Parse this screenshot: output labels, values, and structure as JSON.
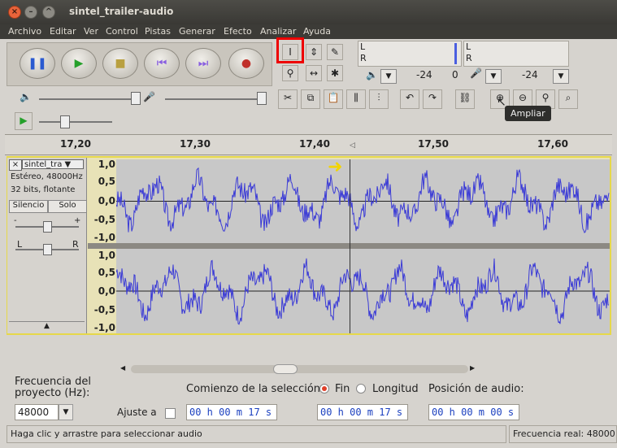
{
  "window": {
    "title": "sintel_trailer-audio"
  },
  "menu": [
    "Archivo",
    "Editar",
    "Ver",
    "Control",
    "Pistas",
    "Generar",
    "Efecto",
    "Analizar",
    "Ayuda"
  ],
  "meters": {
    "play_db": [
      "-24",
      "0"
    ],
    "rec_db": [
      "-24"
    ],
    "L": "L",
    "R": "R"
  },
  "tooltip": "Ampliar",
  "ruler": [
    "17,20",
    "17,30",
    "17,40",
    "17,50",
    "17,60"
  ],
  "track": {
    "name": "sintel_tra",
    "format": "Estéreo, 48000Hz",
    "bits": "32 bits, flotante",
    "mute": "Silencio",
    "solo": "Solo",
    "gain_minus": "-",
    "gain_plus": "+",
    "pan_l": "L",
    "pan_r": "R"
  },
  "scale": [
    "1,0",
    "0,5",
    "0,0",
    "-0,5",
    "-1,0"
  ],
  "bottom": {
    "rate_label": "Frecuencia del proyecto (Hz):",
    "rate_value": "48000",
    "snap_label": "Ajuste a",
    "selection_label": "Comienzo de la selección:",
    "end_label": "Fin",
    "length_label": "Longitud",
    "position_label": "Posición de audio:",
    "time1": "00 h 00 m 17 s",
    "time2": "00 h 00 m 17 s",
    "time3": "00 h 00 m 00 s"
  },
  "status": {
    "left": "Haga clic y arrastre para seleccionar audio",
    "right": "Frecuencia real: 48000"
  }
}
